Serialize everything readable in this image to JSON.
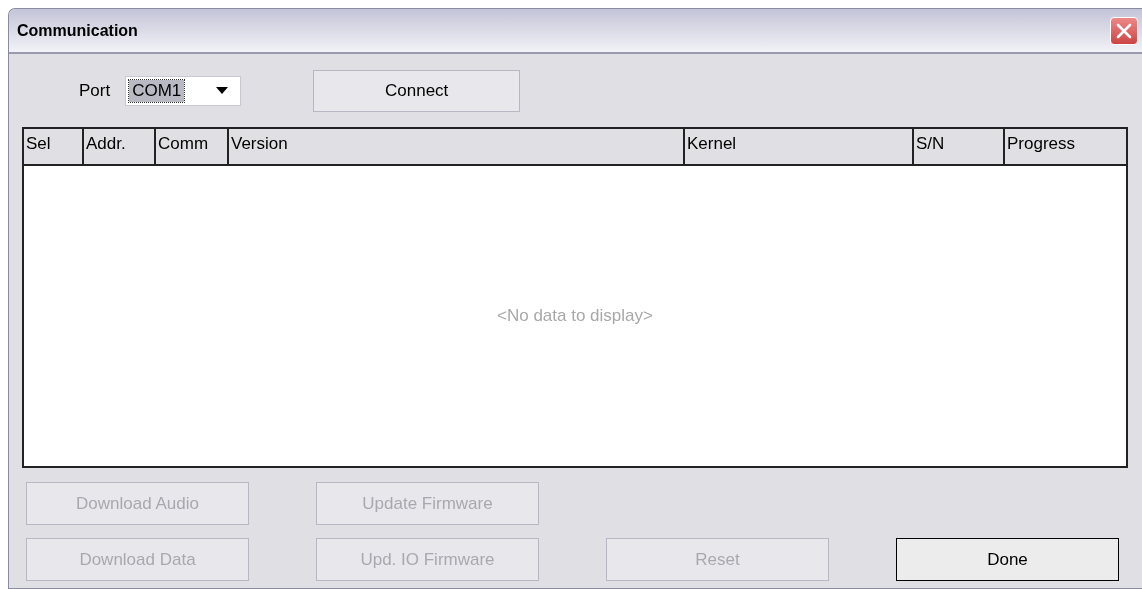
{
  "window": {
    "title": "Communication"
  },
  "port": {
    "label": "Port",
    "value": "COM1"
  },
  "connect_button": {
    "label": "Connect",
    "disabled": false
  },
  "table": {
    "columns": [
      "Sel",
      "Addr.",
      "Comm",
      "Version",
      "Kernel",
      "S/N",
      "Progress"
    ],
    "empty_text": "<No data to display>"
  },
  "button_rows": [
    [
      {
        "label": "Download Audio",
        "disabled": true
      },
      {
        "label": "Update Firmware",
        "disabled": true
      }
    ],
    [
      {
        "label": "Download Data",
        "disabled": true
      },
      {
        "label": "Upd. IO Firmware",
        "disabled": true
      },
      {
        "label": "Reset",
        "disabled": true
      },
      {
        "label": "Done",
        "disabled": false,
        "kind": "default"
      }
    ]
  ]
}
